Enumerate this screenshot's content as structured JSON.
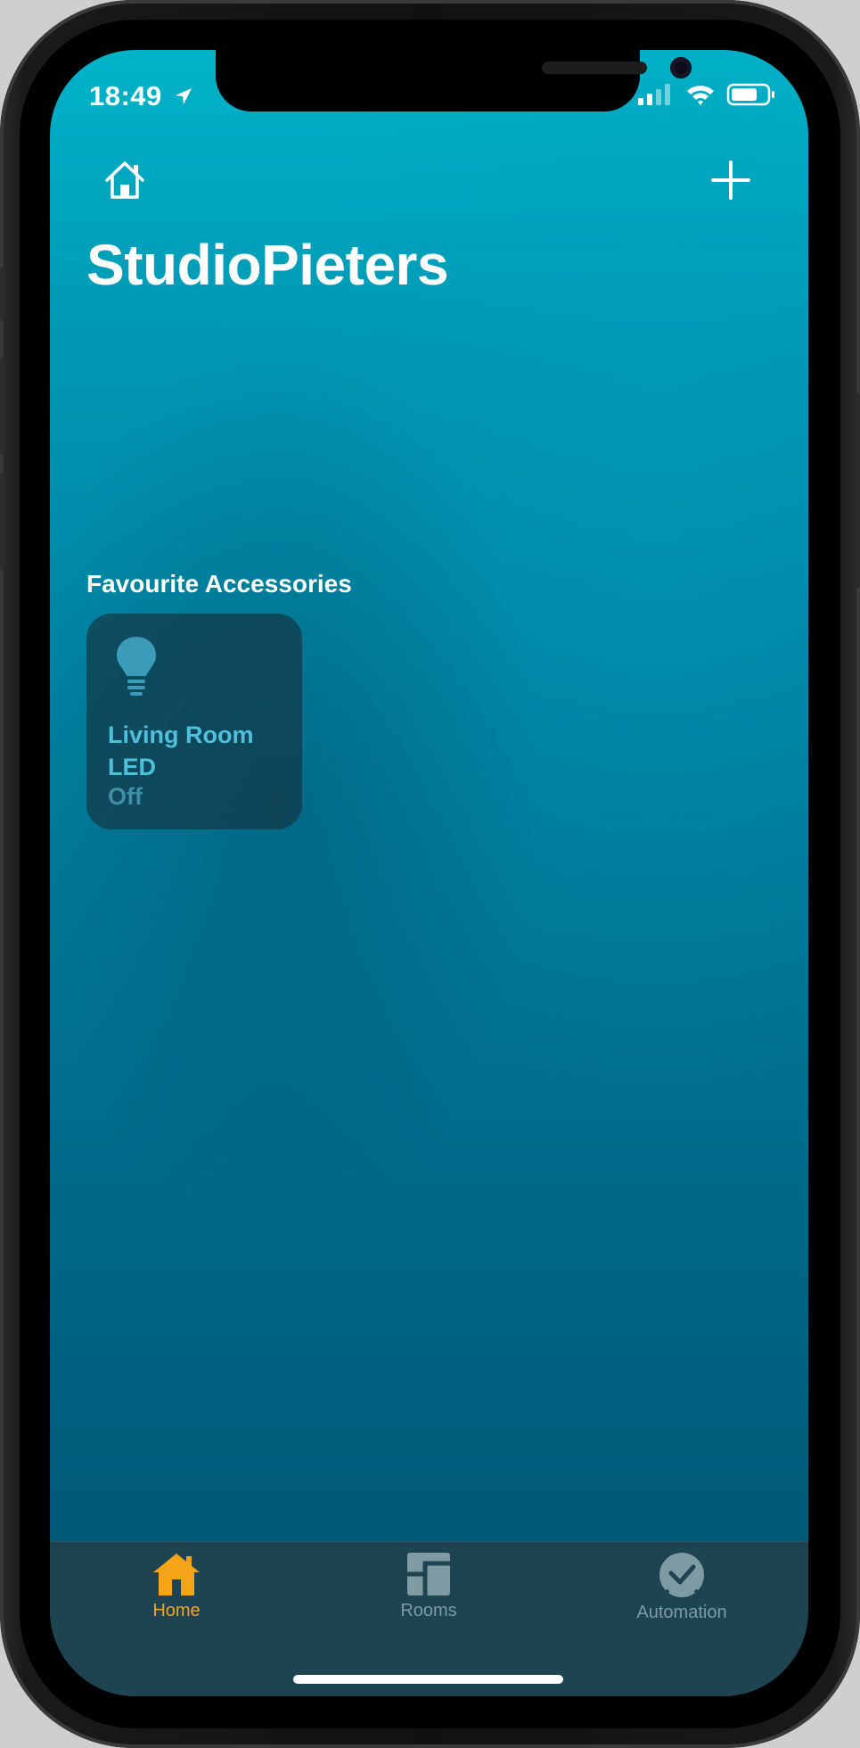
{
  "status_bar": {
    "time": "18:49",
    "icons": [
      "location-arrow-icon",
      "cellular-signal-icon",
      "wifi-icon",
      "battery-icon"
    ]
  },
  "header": {
    "home_icon": "home-outline-icon",
    "add_icon": "plus-icon",
    "title": "StudioPieters"
  },
  "favourites": {
    "section_title": "Favourite Accessories",
    "tiles": [
      {
        "name": "Living Room LED",
        "state": "Off",
        "icon": "lightbulb-icon"
      }
    ]
  },
  "tabbar": {
    "tabs": [
      {
        "label": "Home",
        "icon": "home-filled-icon",
        "selected": true
      },
      {
        "label": "Rooms",
        "icon": "rooms-icon",
        "selected": false
      },
      {
        "label": "Automation",
        "icon": "automation-clock-icon",
        "selected": false
      }
    ],
    "active_color": "#f5a418",
    "inactive_color": "#7e9aa3"
  },
  "colors": {
    "background_top": "#00b3c9",
    "background_bottom": "#005371",
    "tile_text": "#4fc0dc"
  }
}
